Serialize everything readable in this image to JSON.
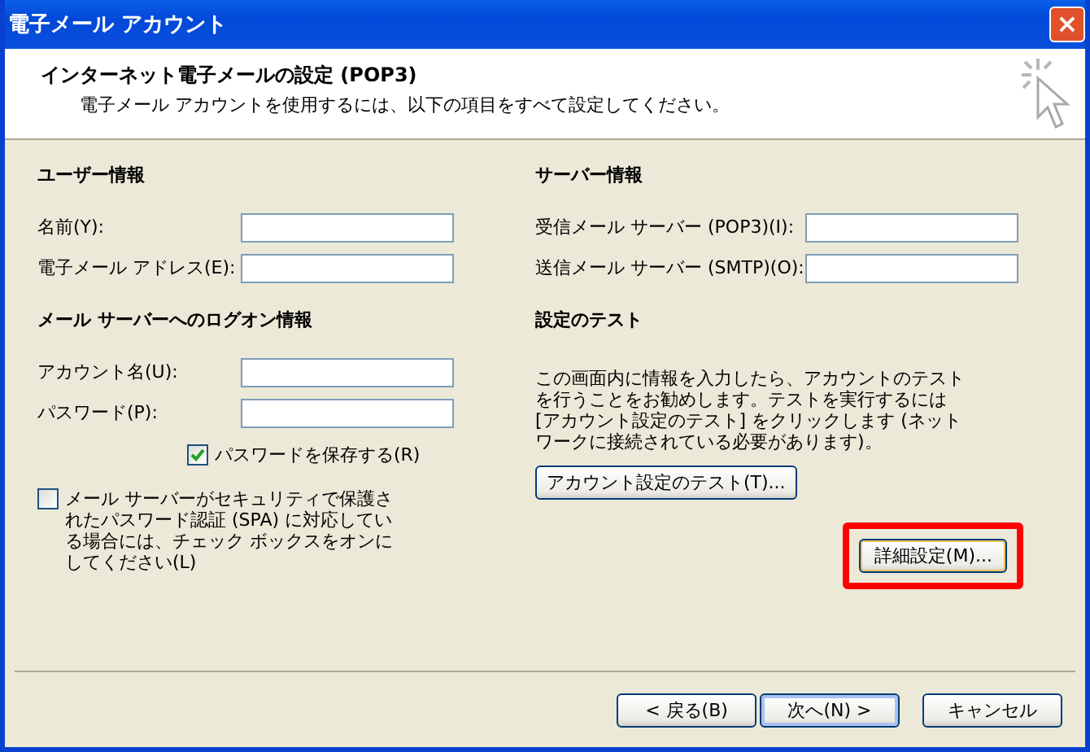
{
  "window": {
    "title": "電子メール アカウント",
    "close": "×"
  },
  "header": {
    "title": "インターネット電子メールの設定 (POP3)",
    "subtitle": "電子メール アカウントを使用するには、以下の項目をすべて設定してください。"
  },
  "user_info": {
    "heading": "ユーザー情報",
    "fields": [
      {
        "label": "名前(Y):"
      },
      {
        "label": "電子メール アドレス(E):"
      }
    ]
  },
  "logon_info": {
    "heading": "メール サーバーへのログオン情報",
    "fields": [
      {
        "label": "アカウント名(U):"
      },
      {
        "label": "パスワード(P):"
      }
    ],
    "remember_password": {
      "label": "パスワードを保存する(R)",
      "checked": true
    }
  },
  "spa": {
    "label": "メール サーバーがセキュリティで保護されたパスワード認証 (SPA) に対応している場合には、チェック ボックスをオンにしてください(L)",
    "checked": false
  },
  "server_info": {
    "heading": "サーバー情報",
    "fields": [
      {
        "label": "受信メール サーバー (POP3)(I):"
      },
      {
        "label": "送信メール サーバー (SMTP)(O):"
      }
    ]
  },
  "test": {
    "heading": "設定のテスト",
    "description": "この画面内に情報を入力したら、アカウントのテストを行うことをお勧めします。テストを実行するには [アカウント設定のテスト] をクリックします (ネットワークに接続されている必要があります)。",
    "button": "アカウント設定のテスト(T)...",
    "advanced_button": {
      "label": "詳細設定(M)...",
      "highlighted": true
    }
  },
  "buttons": [
    {
      "label": "< 戻る(B)",
      "default": false
    },
    {
      "label": "次へ(N) >",
      "default": true
    },
    {
      "label": "キャンセル",
      "default": false
    }
  ]
}
